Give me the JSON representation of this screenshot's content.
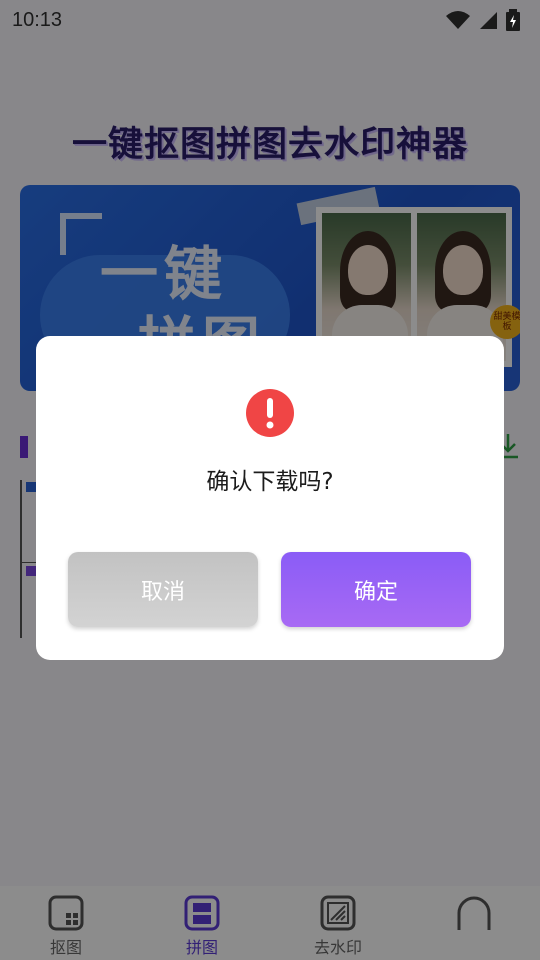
{
  "status_bar": {
    "time": "10:13",
    "icons": [
      "wifi-icon",
      "signal-icon",
      "battery-charging-icon"
    ]
  },
  "header": {
    "title": "一键抠图拼图去水印神器"
  },
  "banner": {
    "line1": "一键",
    "line2": "拼图",
    "sticker": "甜美模板"
  },
  "dialog": {
    "icon": "alert-circle-icon",
    "message": "确认下载吗?",
    "cancel_label": "取消",
    "confirm_label": "确定"
  },
  "bottom_nav": {
    "items": [
      {
        "label": "抠图",
        "icon": "cutout-icon",
        "active": false
      },
      {
        "label": "拼图",
        "icon": "collage-icon",
        "active": true
      },
      {
        "label": "去水印",
        "icon": "watermark-icon",
        "active": false
      },
      {
        "label": "",
        "icon": "profile-icon",
        "active": false
      }
    ]
  },
  "colors": {
    "accent": "#8a5cf6",
    "alert": "#f04545",
    "title": "#2b1e6b",
    "banner": "#2a6fe6"
  }
}
